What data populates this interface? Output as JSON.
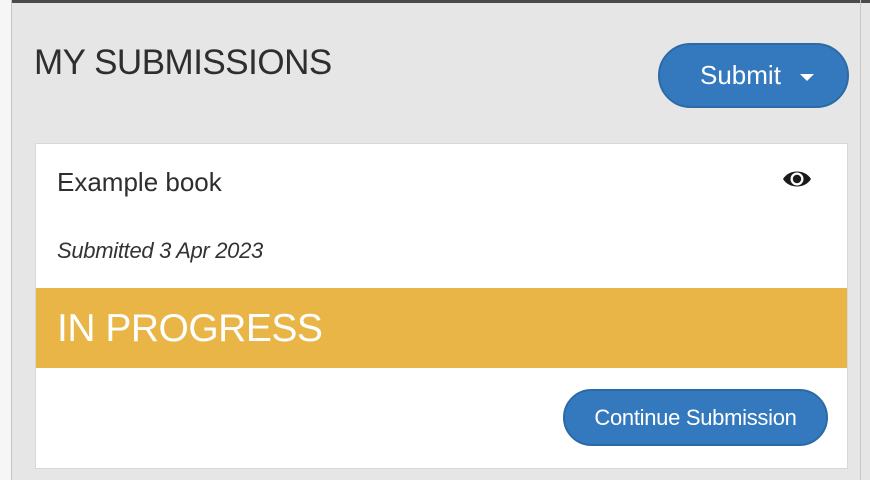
{
  "page": {
    "title": "MY SUBMISSIONS"
  },
  "toolbar": {
    "submit_label": "Submit",
    "submit_icon": "caret-down-icon"
  },
  "submission": {
    "title": "Example book",
    "view_icon": "eye-icon",
    "submitted_text": "Submitted 3 Apr 2023",
    "status": "IN PROGRESS",
    "action_label": "Continue Submission"
  },
  "colors": {
    "background": "#e6e6e6",
    "accent_blue": "#3479bd",
    "status_in_progress": "#e8b546",
    "card_background": "#ffffff"
  }
}
